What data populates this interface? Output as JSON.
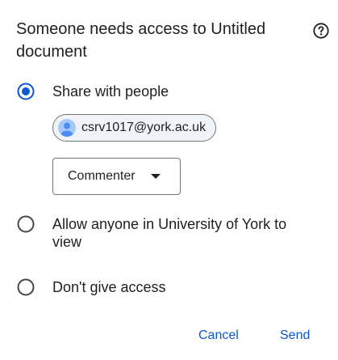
{
  "dialog": {
    "title": "Someone needs access to Untitled document",
    "help_icon": "help-circle-icon"
  },
  "options": [
    {
      "label": "Share with people",
      "selected": true
    },
    {
      "label": "Allow anyone in University of York to view",
      "selected": false
    },
    {
      "label": "Don't give access",
      "selected": false
    }
  ],
  "requester": {
    "email": "csrv1017@york.ac.uk",
    "avatar_icon": "person-icon"
  },
  "role_select": {
    "value": "Commenter",
    "icon": "dropdown-caret-icon"
  },
  "actions": {
    "cancel_label": "Cancel",
    "send_label": "Send"
  },
  "colors": {
    "accent": "#0b57d0",
    "text": "#1f1f1f",
    "outline": "#747775",
    "avatar": "#a8c7fa"
  }
}
